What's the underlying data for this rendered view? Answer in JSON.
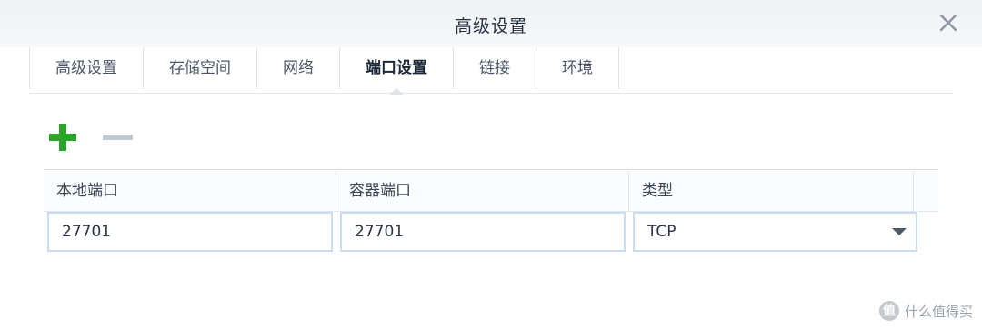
{
  "window": {
    "title": "高级设置"
  },
  "tabs": [
    {
      "label": "高级设置",
      "active": false
    },
    {
      "label": "存储空间",
      "active": false
    },
    {
      "label": "网络",
      "active": false
    },
    {
      "label": "端口设置",
      "active": true
    },
    {
      "label": "链接",
      "active": false
    },
    {
      "label": "环境",
      "active": false
    }
  ],
  "toolbar": {
    "add_icon": "plus-icon",
    "remove_icon": "minus-icon",
    "add_color": "#2aa52a",
    "remove_color": "#c3c9d0"
  },
  "port_table": {
    "headers": {
      "local_port": "本地端口",
      "container_port": "容器端口",
      "type": "类型"
    },
    "rows": [
      {
        "local_port": "27701",
        "container_port": "27701",
        "type": "TCP"
      }
    ]
  },
  "watermark": {
    "badge": "值",
    "text": "什么值得买"
  }
}
